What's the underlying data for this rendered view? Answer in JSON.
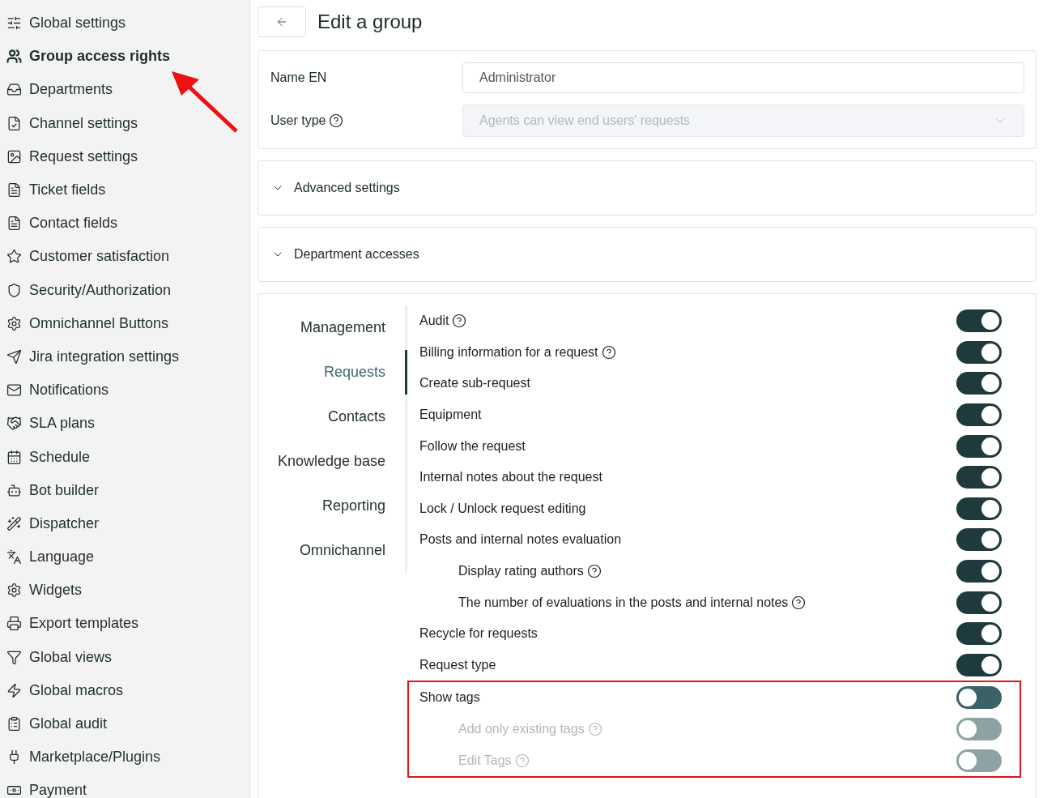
{
  "sidebar": {
    "items": [
      {
        "label": "Global settings",
        "selected": false
      },
      {
        "label": "Group access rights",
        "selected": true
      },
      {
        "label": "Departments",
        "selected": false
      },
      {
        "label": "Channel settings",
        "selected": false
      },
      {
        "label": "Request settings",
        "selected": false
      },
      {
        "label": "Ticket fields",
        "selected": false
      },
      {
        "label": "Contact fields",
        "selected": false
      },
      {
        "label": "Customer satisfaction",
        "selected": false
      },
      {
        "label": "Security/Authorization",
        "selected": false
      },
      {
        "label": "Omnichannel Buttons",
        "selected": false
      },
      {
        "label": "Jira integration settings",
        "selected": false
      },
      {
        "label": "Notifications",
        "selected": false
      },
      {
        "label": "SLA plans",
        "selected": false
      },
      {
        "label": "Schedule",
        "selected": false
      },
      {
        "label": "Bot builder",
        "selected": false
      },
      {
        "label": "Dispatcher",
        "selected": false
      },
      {
        "label": "Language",
        "selected": false
      },
      {
        "label": "Widgets",
        "selected": false
      },
      {
        "label": "Export templates",
        "selected": false
      },
      {
        "label": "Global views",
        "selected": false
      },
      {
        "label": "Global macros",
        "selected": false
      },
      {
        "label": "Global audit",
        "selected": false
      },
      {
        "label": "Marketplace/Plugins",
        "selected": false
      },
      {
        "label": "Payment",
        "selected": false
      }
    ],
    "annotation_arrow": true
  },
  "page": {
    "title": "Edit a group"
  },
  "form": {
    "name_label": "Name EN",
    "name_value": "Administrator",
    "user_type_label": "User type",
    "user_type_placeholder": "Agents can view end users' requests",
    "user_type_disabled": true
  },
  "sections": [
    {
      "title": "Advanced settings",
      "expanded": false
    },
    {
      "title": "Department accesses",
      "expanded": false
    }
  ],
  "permissions": {
    "nav": [
      {
        "label": "Management",
        "selected": false
      },
      {
        "label": "Requests",
        "selected": true
      },
      {
        "label": "Contacts",
        "selected": false
      },
      {
        "label": "Knowledge base",
        "selected": false
      },
      {
        "label": "Reporting",
        "selected": false
      },
      {
        "label": "Omnichannel",
        "selected": false
      }
    ],
    "rows": [
      {
        "label": "Audit",
        "help": true,
        "on": true,
        "disabled": false,
        "highlighted": false
      },
      {
        "label": "Billing information for a request",
        "help": true,
        "on": true,
        "disabled": false,
        "highlighted": false
      },
      {
        "label": "Create sub-request",
        "help": false,
        "on": true,
        "disabled": false,
        "highlighted": false
      },
      {
        "label": "Equipment",
        "help": false,
        "on": true,
        "disabled": false,
        "highlighted": false
      },
      {
        "label": "Follow the request",
        "help": false,
        "on": true,
        "disabled": false,
        "highlighted": false
      },
      {
        "label": "Internal notes about the request",
        "help": false,
        "on": true,
        "disabled": false,
        "highlighted": false
      },
      {
        "label": "Lock / Unlock request editing",
        "help": false,
        "on": true,
        "disabled": false,
        "highlighted": false
      },
      {
        "label": "Posts and internal notes evaluation",
        "help": false,
        "on": true,
        "disabled": false,
        "highlighted": false,
        "children": [
          {
            "label": "Display rating authors",
            "help": true,
            "on": true,
            "disabled": false
          },
          {
            "label": "The number of evaluations in the posts and internal notes",
            "help": true,
            "on": true,
            "disabled": false
          }
        ]
      },
      {
        "label": "Recycle for requests",
        "help": false,
        "on": true,
        "disabled": false,
        "highlighted": false
      },
      {
        "label": "Request type",
        "help": false,
        "on": true,
        "disabled": false,
        "highlighted": false
      },
      {
        "label": "Show tags",
        "help": false,
        "on": false,
        "disabled": false,
        "highlighted": true,
        "children": [
          {
            "label": "Add only existing tags",
            "help": true,
            "on": false,
            "disabled": true
          },
          {
            "label": "Edit Tags",
            "help": true,
            "on": false,
            "disabled": true
          }
        ]
      }
    ]
  }
}
